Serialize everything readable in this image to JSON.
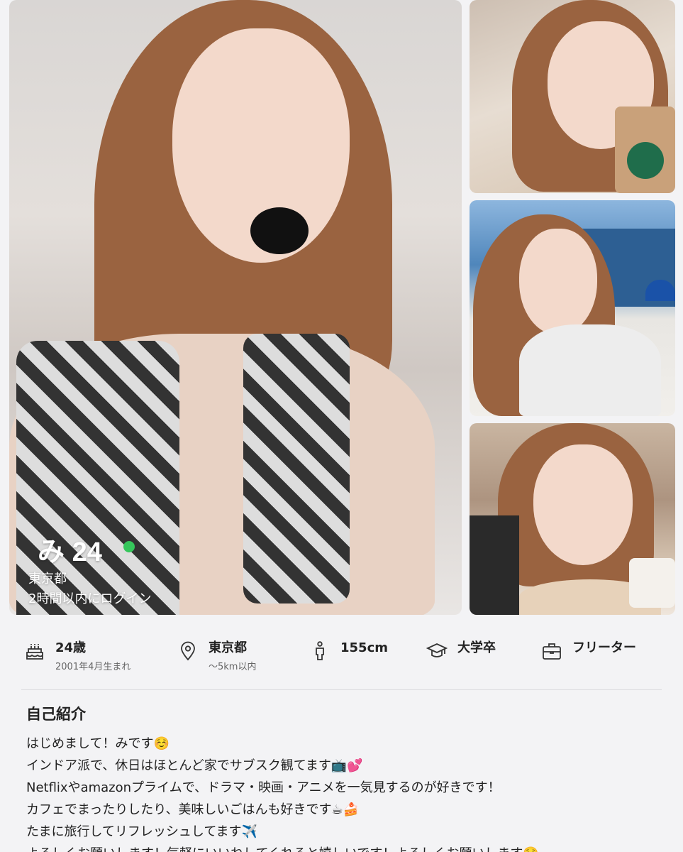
{
  "profile": {
    "name": "み",
    "age": "24",
    "online": true,
    "location": "東京都",
    "last_login": "2時間以内にログイン",
    "status_color": "#35c65b"
  },
  "attributes": [
    {
      "icon": "birthday-cake-icon",
      "main": "24歳",
      "sub": "2001年4月生まれ"
    },
    {
      "icon": "location-pin-icon",
      "main": "東京都",
      "sub": "〜5km以内"
    },
    {
      "icon": "height-icon",
      "main": "155cm",
      "sub": ""
    },
    {
      "icon": "graduation-cap-icon",
      "main": "大学卒",
      "sub": ""
    },
    {
      "icon": "briefcase-icon",
      "main": "フリーター",
      "sub": ""
    }
  ],
  "intro": {
    "title": "自己紹介",
    "lines": [
      "はじめまして！みです☺️",
      "インドア派で、休日はほとんど家でサブスク観てます📺💕",
      "Netflixやamazonプライムで、ドラマ・映画・アニメを一気見するのが好きです！",
      "カフェでまったりしたり、美味しいごはんも好きです☕🍰",
      "たまに旅行してリフレッシュしてます✈️",
      "よろしくお願いします！気軽にいいねしてくれると嬉しいです！よろしくお願いします☺️"
    ]
  }
}
